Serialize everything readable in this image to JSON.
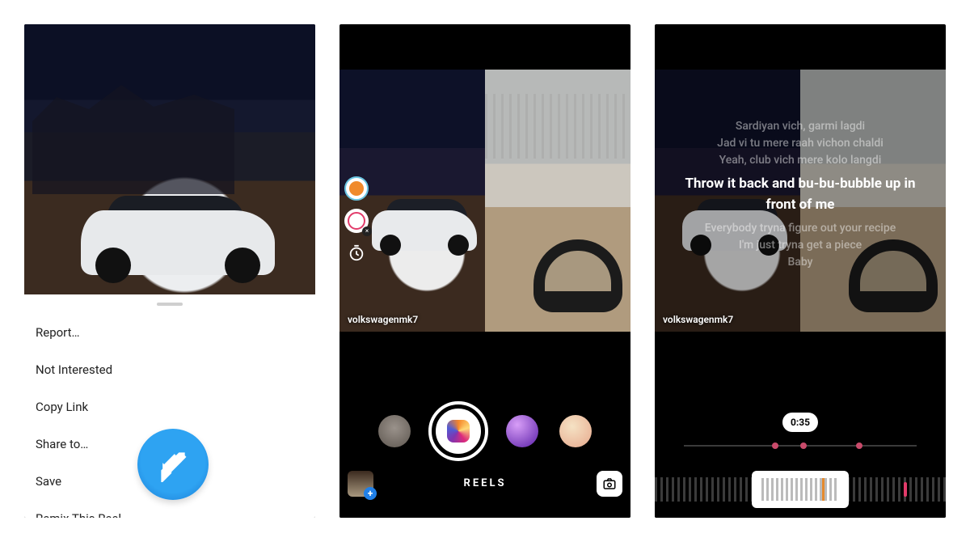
{
  "screen1": {
    "sheet_items": [
      {
        "label": "Report…"
      },
      {
        "label": "Not Interested"
      },
      {
        "label": "Copy Link"
      },
      {
        "label": "Share to…"
      },
      {
        "label": "Save"
      },
      {
        "label": "Remix This Reel"
      }
    ]
  },
  "screen2": {
    "user_tag": "volkswagenmk7",
    "mode_label": "REELS",
    "gallery_plus": "+"
  },
  "screen3": {
    "user_tag": "volkswagenmk7",
    "timestamp": "0:35",
    "lyrics": {
      "l1": "Sardiyan vich, garmi lagdi",
      "l2": "Jad vi tu mere raah vichon chaldi",
      "l3": "Yeah, club vich mere kolo langdi",
      "highlight": "Throw it back and bu-bu-bubble up in front of me",
      "l4": "Everybody tryna figure out your recipe",
      "l5": "I'm just tryna get a piece",
      "l6": "Baby"
    }
  }
}
